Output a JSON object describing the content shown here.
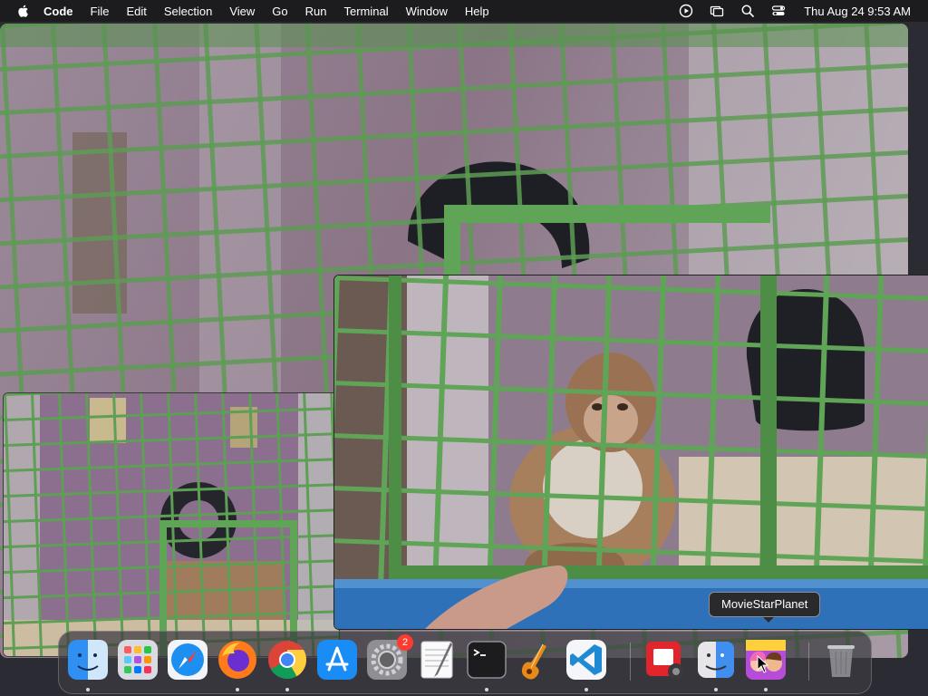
{
  "menubar": {
    "app_name": "Code",
    "items": [
      "File",
      "Edit",
      "Selection",
      "View",
      "Go",
      "Run",
      "Terminal",
      "Window",
      "Help"
    ],
    "clock": "Thu Aug 24  9:53 AM",
    "status_icons": [
      "play-circle-icon",
      "screen-mirroring-icon",
      "search-icon",
      "control-center-icon"
    ]
  },
  "tooltip": {
    "text": "MovieStarPlanet"
  },
  "dock": {
    "items": [
      {
        "name": "Finder",
        "icon": "finder-icon",
        "running": true
      },
      {
        "name": "Launchpad",
        "icon": "launchpad-icon",
        "running": false
      },
      {
        "name": "Safari",
        "icon": "safari-icon",
        "running": false
      },
      {
        "name": "Firefox",
        "icon": "firefox-icon",
        "running": true
      },
      {
        "name": "Chrome",
        "icon": "chrome-icon",
        "running": true
      },
      {
        "name": "App Store",
        "icon": "app-store-icon",
        "running": false
      },
      {
        "name": "System Settings",
        "icon": "system-settings-icon",
        "running": false,
        "badge": "2"
      },
      {
        "name": "TextEdit",
        "icon": "textedit-icon",
        "running": false
      },
      {
        "name": "Terminal",
        "icon": "terminal-icon",
        "running": true
      },
      {
        "name": "GarageBand",
        "icon": "garageband-icon",
        "running": false
      },
      {
        "name": "Visual Studio Code",
        "icon": "vscode-icon",
        "running": true
      },
      {
        "name": "Photo Booth",
        "icon": "photo-booth-icon",
        "running": false
      },
      {
        "name": "Finder Window",
        "icon": "finder-window-icon",
        "running": true
      },
      {
        "name": "MovieStarPlanet",
        "icon": "moviestarplanet-icon",
        "running": true
      },
      {
        "name": "Trash",
        "icon": "trash-icon",
        "running": false
      }
    ]
  },
  "colors": {
    "menubar_bg": "#1c1c1e",
    "cage_green": "#5e9e55",
    "wall_purple": "#8f7a8e",
    "badge_red": "#ff3b30"
  }
}
